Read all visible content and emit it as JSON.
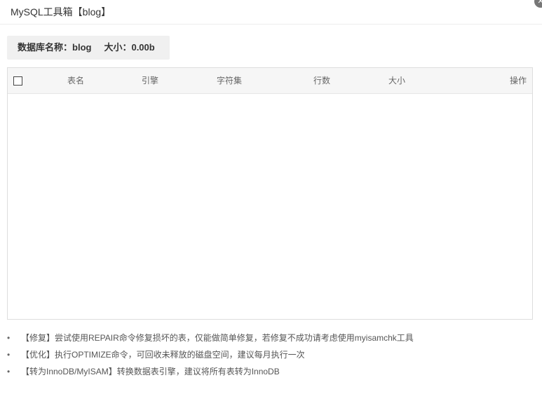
{
  "window": {
    "title": "MySQL工具箱【blog】",
    "close_symbol": "✕"
  },
  "dbinfo": {
    "name_label": "数据库名称：",
    "name_value": "blog",
    "size_label": "大小：",
    "size_value": "0.00b"
  },
  "table": {
    "columns": [
      "表名",
      "引擎",
      "字符集",
      "行数",
      "大小",
      "操作"
    ],
    "rows": []
  },
  "notes": {
    "bullet": "•",
    "items": [
      "【修复】尝试使用REPAIR命令修复损坏的表，仅能做简单修复，若修复不成功请考虑使用myisamchk工具",
      "【优化】执行OPTIMIZE命令，可回收未释放的磁盘空间，建议每月执行一次",
      "【转为InnoDB/MyISAM】转换数据表引擎，建议将所有表转为InnoDB"
    ]
  }
}
